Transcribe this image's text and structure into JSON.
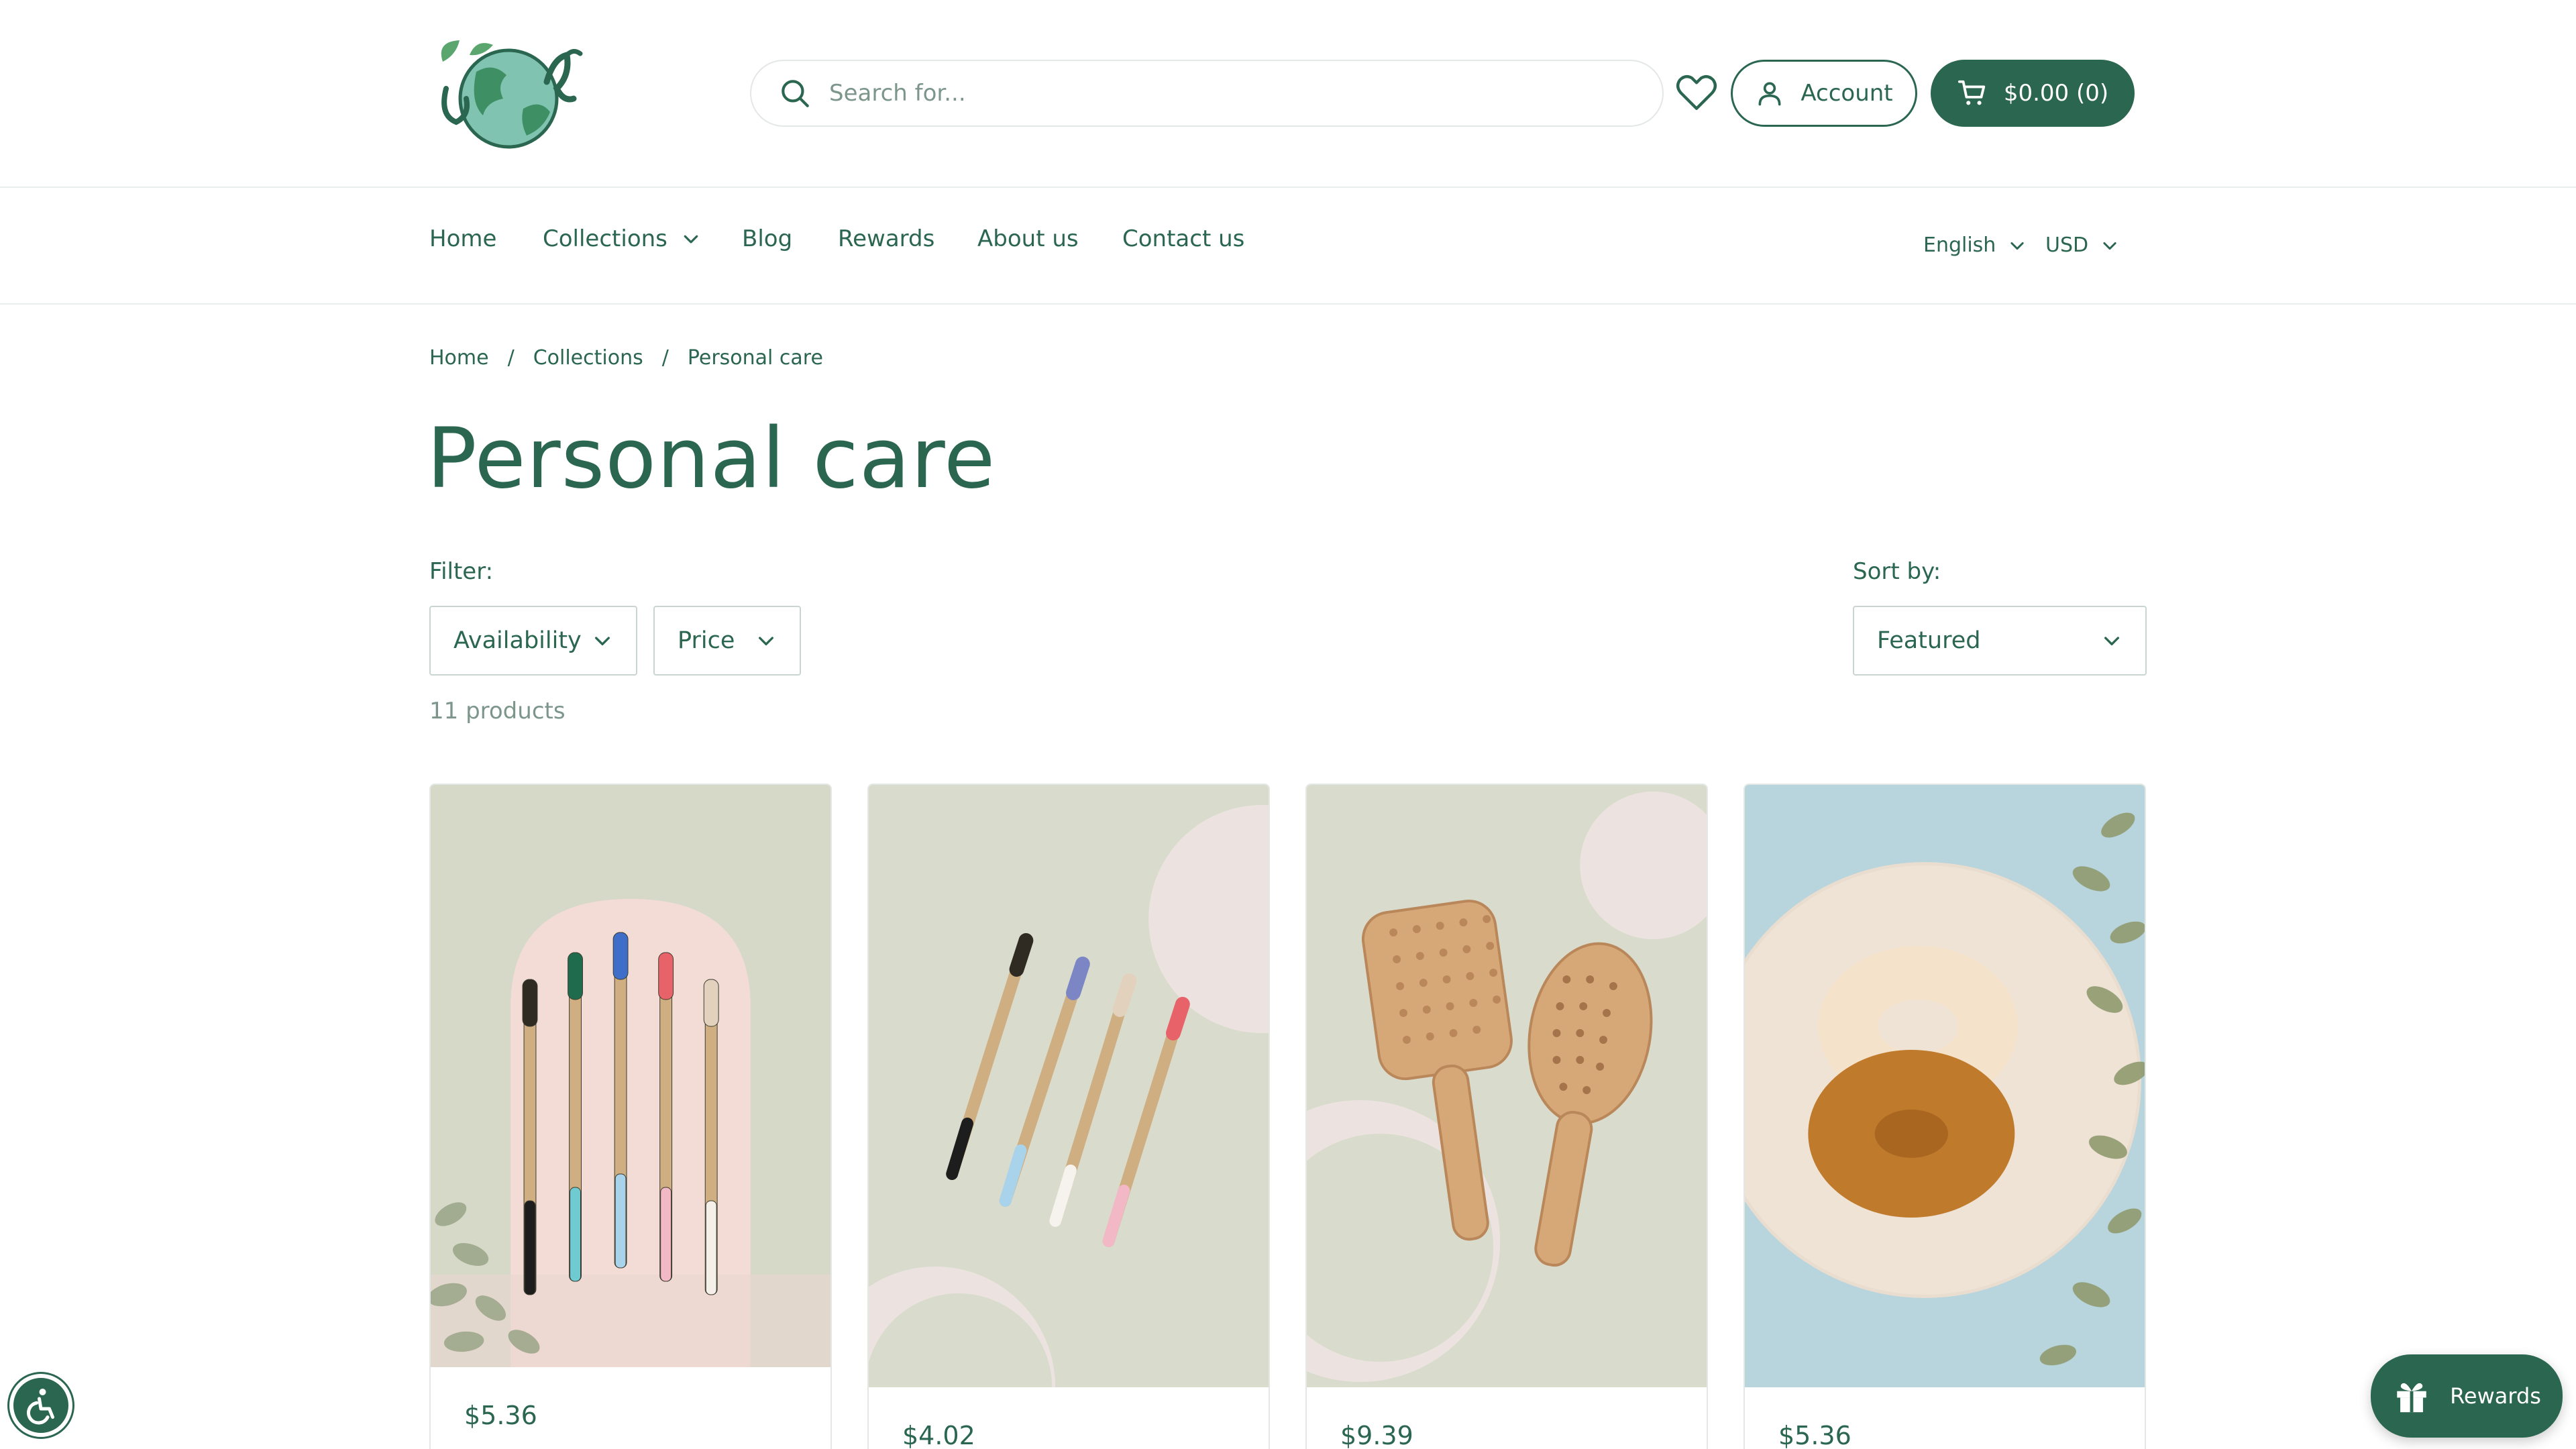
{
  "header": {
    "search_placeholder": "Search for...",
    "account_label": "Account",
    "cart_label": "$0.00 (0)"
  },
  "nav": {
    "items": [
      {
        "label": "Home"
      },
      {
        "label": "Collections"
      },
      {
        "label": "Blog"
      },
      {
        "label": "Rewards"
      },
      {
        "label": "About us"
      },
      {
        "label": "Contact us"
      }
    ],
    "language": "English",
    "currency": "USD"
  },
  "breadcrumb": [
    "Home",
    "Collections",
    "Personal care"
  ],
  "breadcrumb_sep": "/",
  "page_title": "Personal care",
  "filters": {
    "label": "Filter:",
    "availability": "Availability",
    "price": "Price",
    "sort_label": "Sort by:",
    "sort_value": "Featured",
    "count": "11 products"
  },
  "products": [
    {
      "price": "$5.36"
    },
    {
      "price": "$4.02"
    },
    {
      "price": "$9.39"
    },
    {
      "price": "$5.36"
    }
  ],
  "floating": {
    "rewards_label": "Rewards"
  },
  "icons": [
    "logo-globe-icon",
    "search-icon",
    "heart-icon",
    "user-icon",
    "cart-icon",
    "chevron-down-icon",
    "accessibility-icon",
    "gift-icon"
  ],
  "colors": {
    "brand": "#2a6650",
    "muted": "#7c968b",
    "border": "#e3e8e5"
  }
}
